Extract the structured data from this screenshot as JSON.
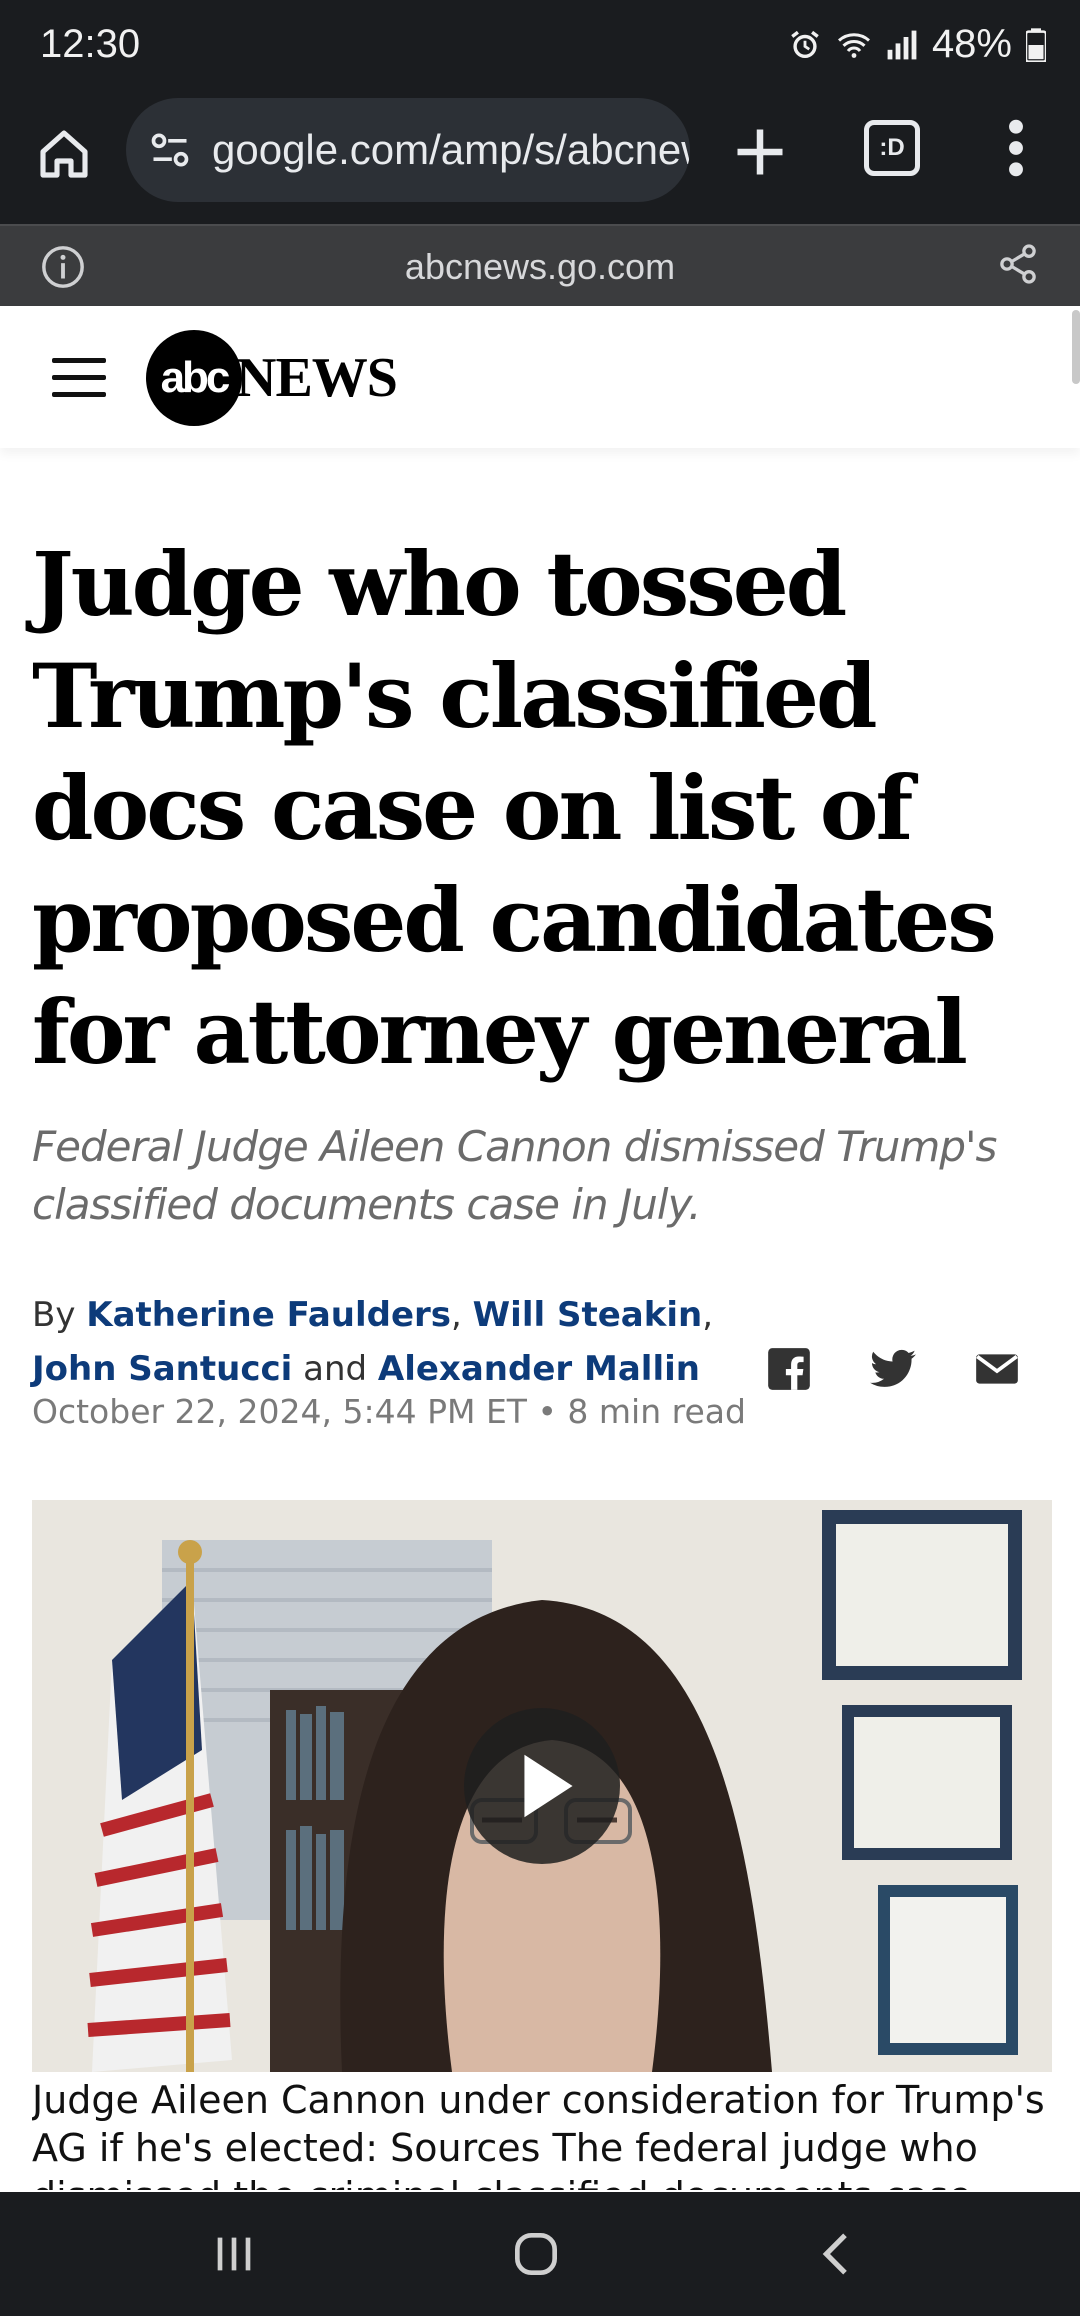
{
  "status_bar": {
    "time": "12:30",
    "battery": "48%"
  },
  "browser": {
    "url": "google.com/amp/s/abcnews.go.com",
    "tab_switcher_label": ":D",
    "domain": "abcnews.go.com"
  },
  "site": {
    "logo_abc": "abc",
    "logo_news": "NEWS"
  },
  "article": {
    "headline": "Judge who tossed Trump's classified docs case on list of proposed candidates for attorney general",
    "subhead": "Federal Judge Aileen Cannon dismissed Trump's classified documents case in July.",
    "by_prefix": "By",
    "authors": [
      "Katherine Faulders",
      "Will Steakin",
      "John Santucci",
      "Alexander Mallin"
    ],
    "author_sep": ",",
    "author_and": "and",
    "date": "October 22, 2024, 5:44 PM ET",
    "read_time": "8 min read",
    "caption": "Judge Aileen Cannon under consideration for Trump's AG if he's elected: Sources The federal judge who dismissed the criminal classified documents case"
  },
  "icons": {
    "home": "home-icon",
    "tune": "site-settings-icon",
    "plus": "new-tab-icon",
    "menu": "more-vert-icon",
    "info": "info-icon",
    "share": "share-icon",
    "facebook": "facebook-icon",
    "twitter": "twitter-icon",
    "email": "email-icon",
    "play": "play-icon",
    "recents": "recents-icon",
    "home_nav": "home-nav-icon",
    "back": "back-icon"
  },
  "colors": {
    "chrome_dark": "#1a1c1f",
    "author_link": "#0d3b7a",
    "subhead": "#6b6b6b"
  }
}
